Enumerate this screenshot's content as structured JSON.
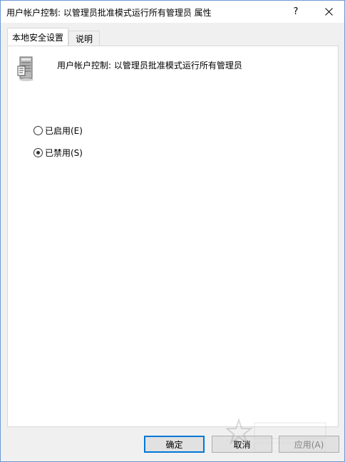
{
  "window": {
    "title": "用户帐户控制: 以管理员批准模式运行所有管理员 属性",
    "help_label": "?",
    "close_icon": "close-icon"
  },
  "tabs": [
    {
      "label": "本地安全设置",
      "active": true
    },
    {
      "label": "说明",
      "active": false
    }
  ],
  "policy": {
    "icon": "server-policy-icon",
    "name": "用户帐户控制: 以管理员批准模式运行所有管理员"
  },
  "options": [
    {
      "label": "已启用(E)",
      "checked": false
    },
    {
      "label": "已禁用(S)",
      "checked": true
    }
  ],
  "buttons": {
    "ok": "确定",
    "cancel": "取消",
    "apply": "应用(A)"
  },
  "colors": {
    "accent": "#0078d7",
    "disabled_text": "#838383"
  }
}
